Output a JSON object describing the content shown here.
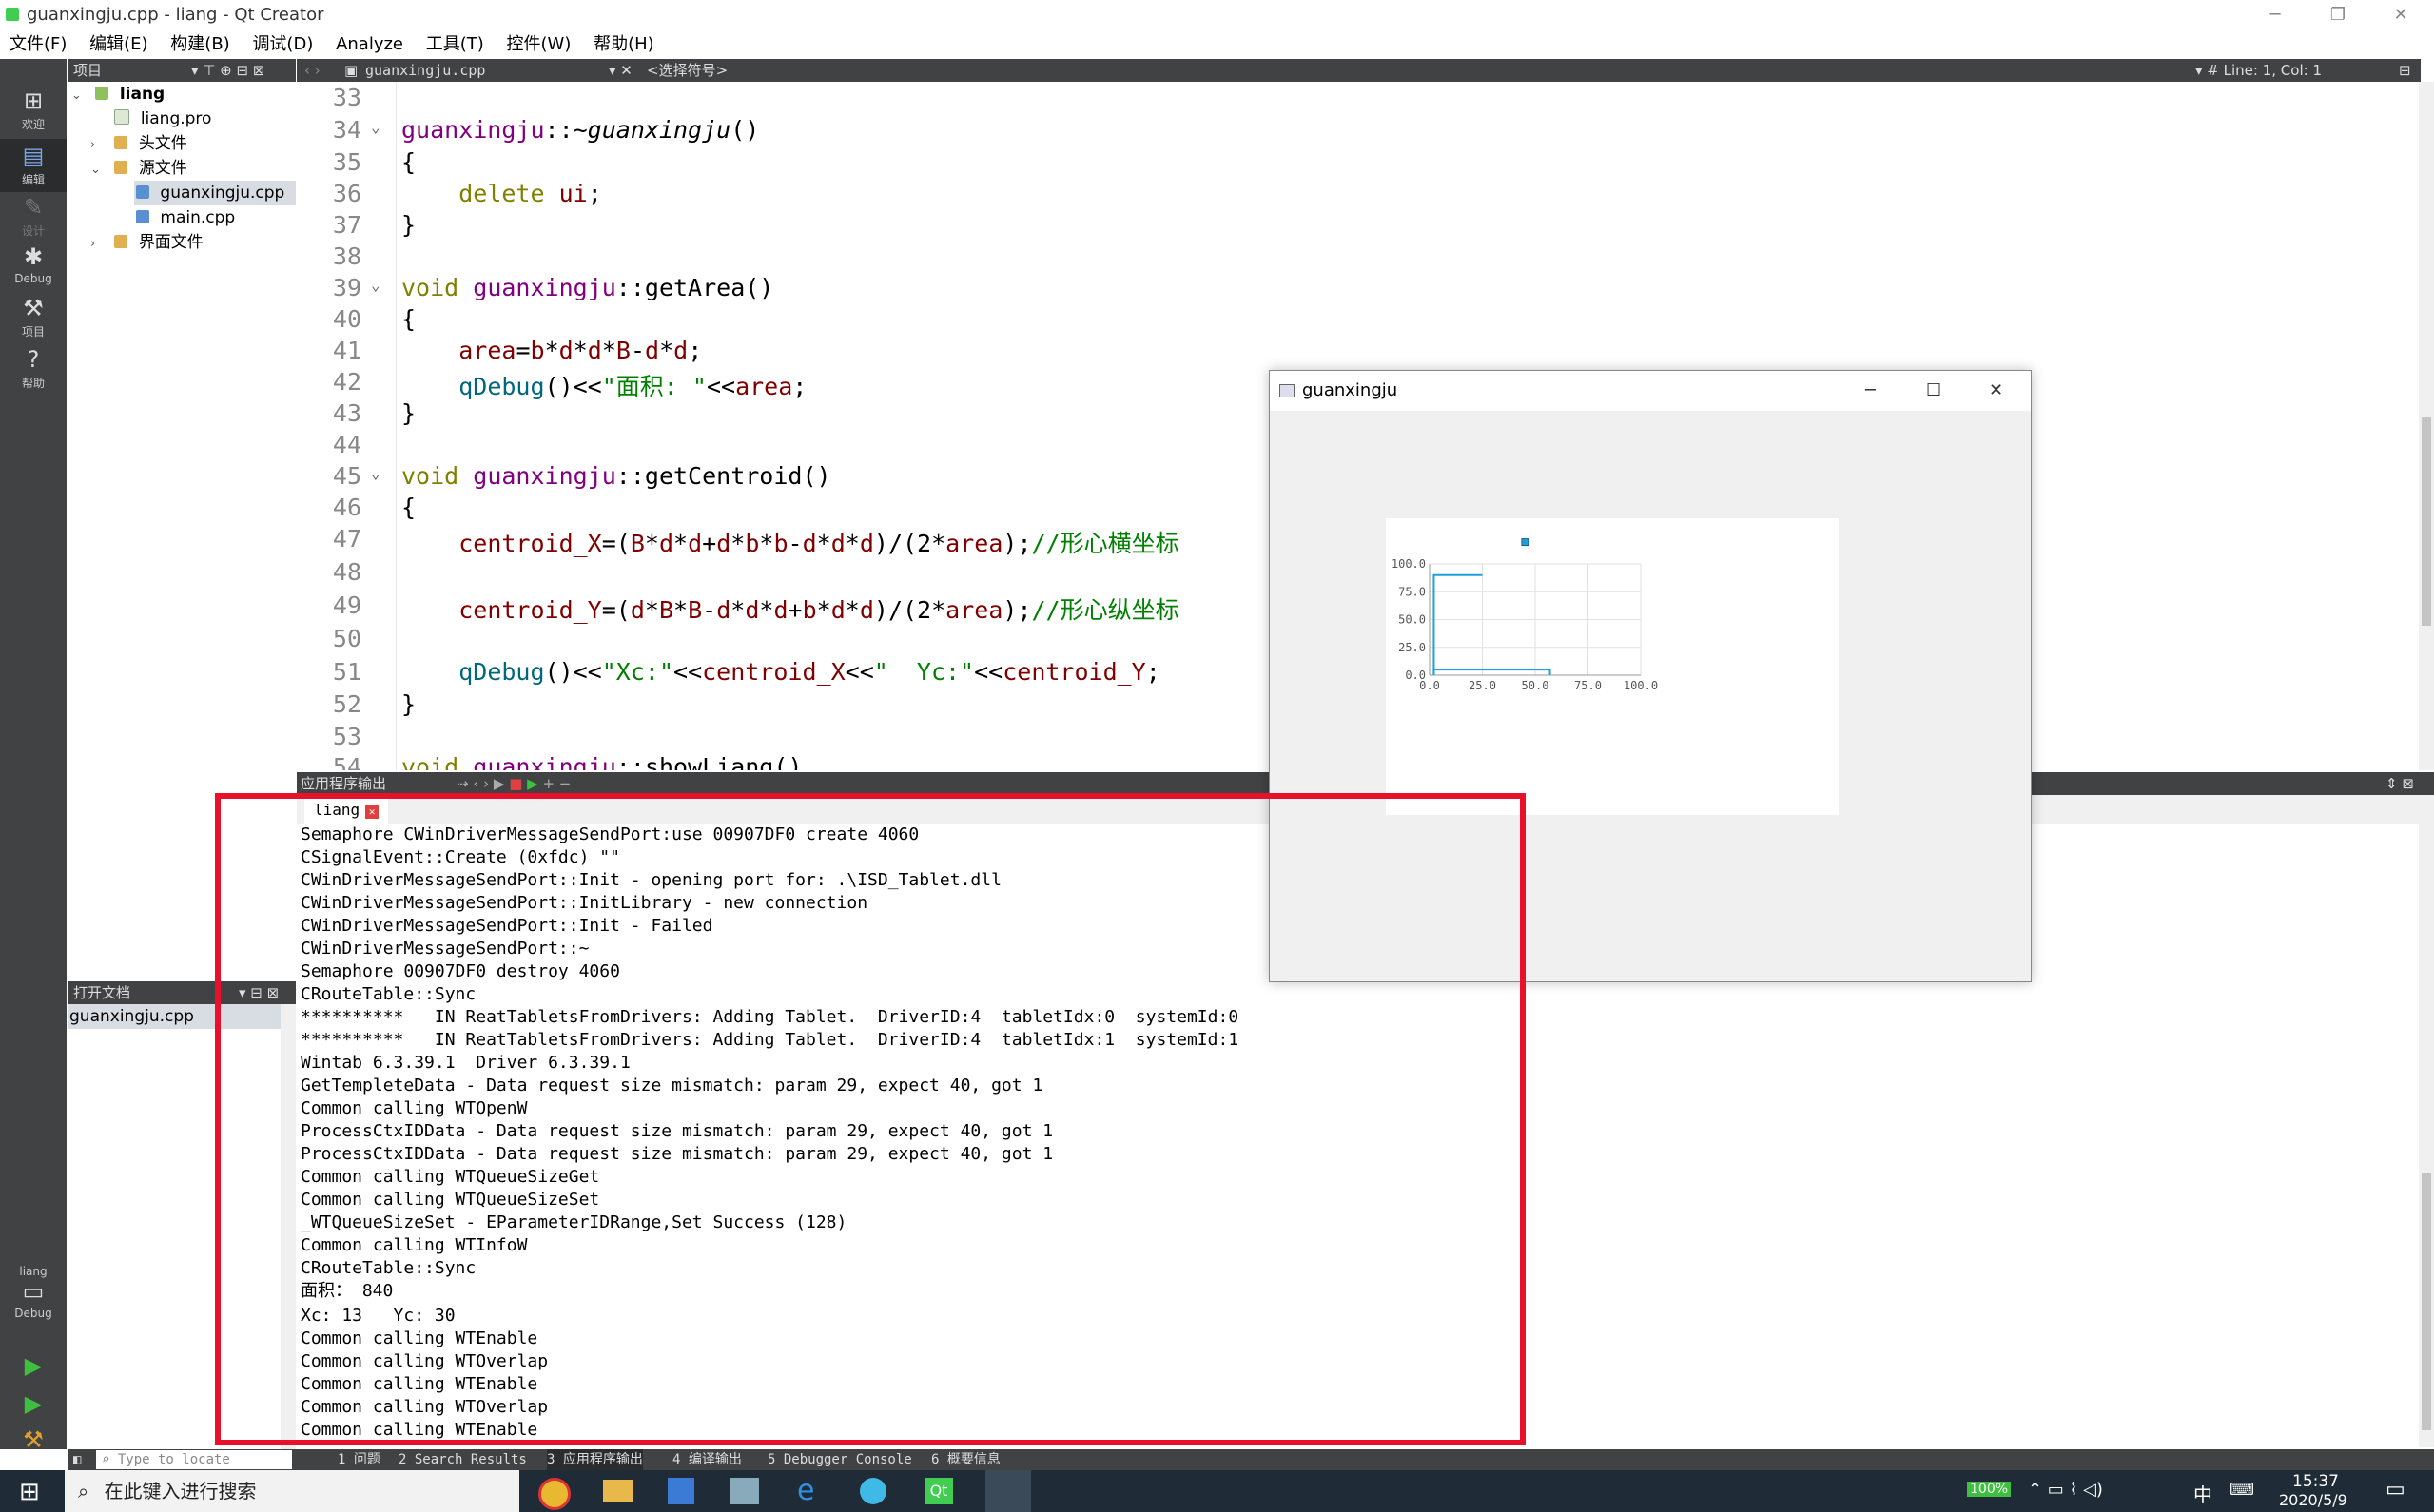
{
  "window": {
    "title": "guanxingju.cpp - liang - Qt Creator"
  },
  "menu": [
    "文件(F)",
    "编辑(E)",
    "构建(B)",
    "调试(D)",
    "Analyze",
    "工具(T)",
    "控件(W)",
    "帮助(H)"
  ],
  "modes": [
    {
      "label": "欢迎",
      "icon": "grid-icon"
    },
    {
      "label": "编辑",
      "icon": "edit-icon"
    },
    {
      "label": "设计",
      "icon": "pencil-icon"
    },
    {
      "label": "Debug",
      "icon": "bug-icon"
    },
    {
      "label": "项目",
      "icon": "wrench-icon"
    },
    {
      "label": "帮助",
      "icon": "help-icon"
    }
  ],
  "kit": {
    "project": "liang",
    "config": "Debug"
  },
  "project_panel": {
    "title": "项目"
  },
  "tree": [
    {
      "label": "liang",
      "level": 0,
      "arrow": "⌄"
    },
    {
      "label": "liang.pro",
      "level": 1,
      "arrow": ""
    },
    {
      "label": "头文件",
      "level": 1,
      "arrow": "›"
    },
    {
      "label": "源文件",
      "level": 1,
      "arrow": "⌄"
    },
    {
      "label": "guanxingju.cpp",
      "level": 2,
      "arrow": "",
      "selected": true
    },
    {
      "label": "main.cpp",
      "level": 2,
      "arrow": ""
    },
    {
      "label": "界面文件",
      "level": 1,
      "arrow": "›"
    }
  ],
  "open_docs": {
    "title": "打开文档",
    "items": [
      "guanxingju.cpp"
    ]
  },
  "editor": {
    "file": "guanxingju.cpp",
    "symbol": "<选择符号>",
    "position": "Line: 1, Col: 1"
  },
  "output_panel": {
    "title": "应用程序输出",
    "tab": "liang",
    "lines": [
      "Semaphore CWinDriverMessageSendPort:use 00907DF0 create 4060",
      "CSignalEvent::Create (0xfdc) \"\"",
      "CWinDriverMessageSendPort::Init - opening port for: .\\ISD_Tablet.dll",
      "CWinDriverMessageSendPort::InitLibrary - new connection",
      "CWinDriverMessageSendPort::Init - Failed",
      "CWinDriverMessageSendPort::~",
      "Semaphore 00907DF0 destroy 4060",
      "CRouteTable::Sync",
      "**********   IN ReatTabletsFromDrivers: Adding Tablet.  DriverID:4  tabletIdx:0  systemId:0",
      "**********   IN ReatTabletsFromDrivers: Adding Tablet.  DriverID:4  tabletIdx:1  systemId:1",
      "Wintab 6.3.39.1  Driver 6.3.39.1",
      "GetTempleteData - Data request size mismatch: param 29, expect 40, got 1",
      "Common calling WTOpenW",
      "ProcessCtxIDData - Data request size mismatch: param 29, expect 40, got 1",
      "ProcessCtxIDData - Data request size mismatch: param 29, expect 40, got 1",
      "Common calling WTQueueSizeGet",
      "Common calling WTQueueSizeSet",
      "_WTQueueSizeSet - EParameterIDRange,Set Success (128)",
      "Common calling WTInfoW",
      "CRouteTable::Sync",
      "面积： 840",
      "Xc: 13   Yc: 30",
      "Common calling WTEnable",
      "Common calling WTOverlap",
      "Common calling WTEnable",
      "Common calling WTOverlap",
      "Common calling WTEnable"
    ]
  },
  "bottom_tabs": [
    "Type to locate (Ctrl+...",
    "1 问题",
    "2 Search Results",
    "3 应用程序输出",
    "4 编译输出",
    "5 Debugger Console",
    "6 概要信息"
  ],
  "popup": {
    "title": "guanxingju"
  },
  "chart_data": {
    "type": "line",
    "series": [
      {
        "points": [
          [
            2,
            0
          ],
          [
            2,
            90
          ],
          [
            25,
            90
          ]
        ]
      },
      {
        "points": [
          [
            2,
            0
          ],
          [
            2,
            5
          ],
          [
            57,
            5
          ],
          [
            57,
            0
          ]
        ]
      }
    ],
    "marker": [
      [
        45,
        120
      ]
    ],
    "xlim": [
      0,
      100
    ],
    "ylim": [
      0,
      100
    ],
    "xticks": [
      "0.0",
      "25.0",
      "50.0",
      "75.0",
      "100.0"
    ],
    "yticks": [
      "0.0",
      "25.0",
      "50.0",
      "75.0",
      "100.0"
    ],
    "grid": true,
    "series_color": "#209fdf"
  },
  "taskbar": {
    "search_placeholder": "在此键入进行搜索",
    "battery": "100%",
    "ime": "中",
    "time": "15:37",
    "date": "2020/5/9"
  },
  "colors": {
    "highlight": "#e8102a",
    "sidebar": "#404244"
  }
}
